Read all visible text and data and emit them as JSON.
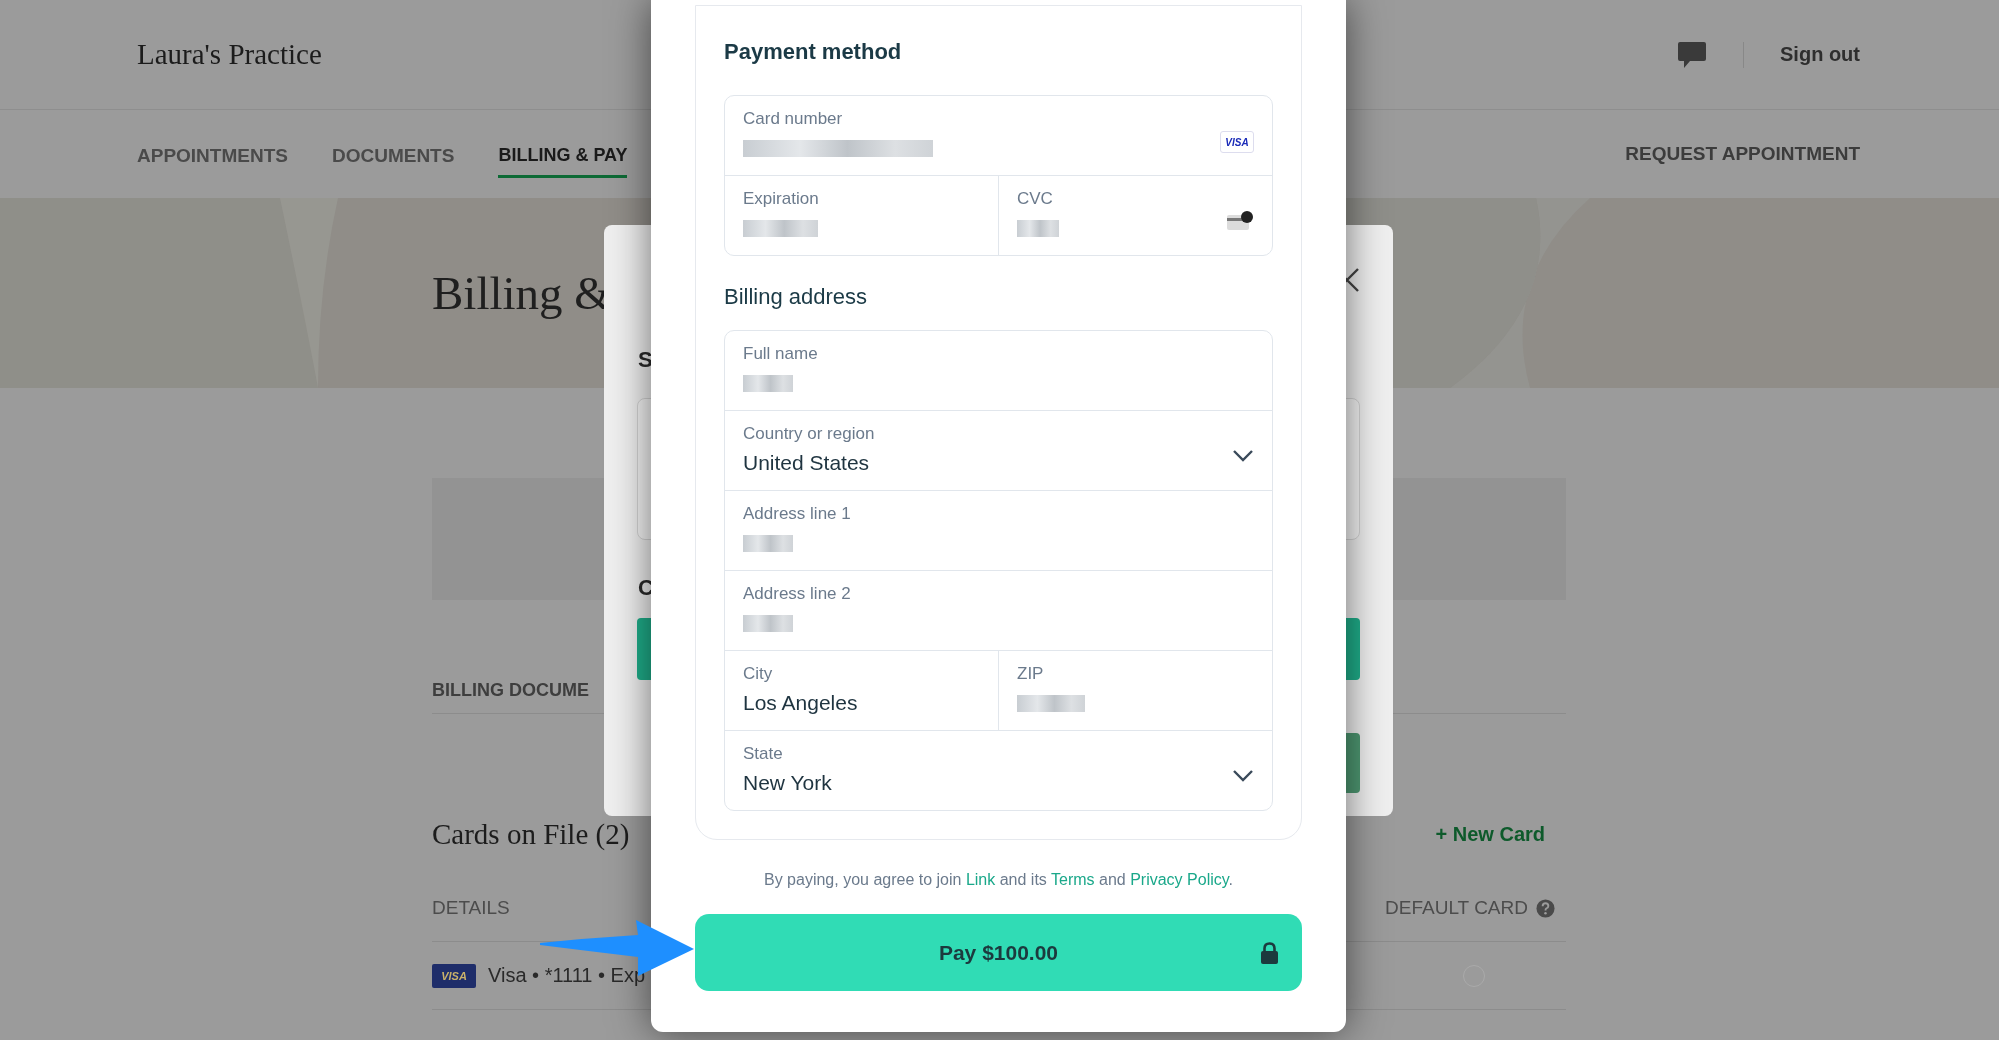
{
  "header": {
    "practice_name": "Laura's Practice",
    "sign_out": "Sign out"
  },
  "nav": {
    "tabs": [
      {
        "label": "APPOINTMENTS",
        "selected": false
      },
      {
        "label": "DOCUMENTS",
        "selected": false
      },
      {
        "label": "BILLING & PAY",
        "selected": true
      }
    ],
    "request_button": "REQUEST APPOINTMENT"
  },
  "page": {
    "title": "Billing &",
    "billing_documents_heading": "BILLING DOCUME",
    "cards_heading": "Cards on File (2)",
    "new_card_link": "+ New Card",
    "columns": [
      "DETAILS",
      "DEFAULT CARD"
    ],
    "cards": [
      {
        "brand": "VISA",
        "details": "Visa • *1111 • Exp",
        "default": false
      }
    ]
  },
  "background_dialog": {
    "heading_1": "S",
    "heading_2": "C"
  },
  "payment_dialog": {
    "payment_method": {
      "heading": "Payment method",
      "rows": [
        {
          "fields": [
            {
              "label": "Card number",
              "kind": "cardnumber",
              "redacted": true,
              "brand": "VISA"
            }
          ]
        },
        {
          "fields": [
            {
              "label": "Expiration",
              "kind": "expiry",
              "redacted": true
            },
            {
              "label": "CVC",
              "kind": "cvc",
              "redacted": true
            }
          ]
        }
      ]
    },
    "billing_address": {
      "heading": "Billing address",
      "rows": [
        {
          "fields": [
            {
              "label": "Full name",
              "kind": "text",
              "redacted": true
            }
          ]
        },
        {
          "fields": [
            {
              "label": "Country or region",
              "kind": "select",
              "value": "United States",
              "redacted": false
            }
          ]
        },
        {
          "fields": [
            {
              "label": "Address line 1",
              "kind": "text",
              "redacted": true
            }
          ]
        },
        {
          "fields": [
            {
              "label": "Address line 2",
              "kind": "text",
              "redacted": true
            }
          ]
        },
        {
          "fields": [
            {
              "label": "City",
              "kind": "text",
              "value": "Los Angeles",
              "redacted": false
            },
            {
              "label": "ZIP",
              "kind": "zip",
              "redacted": true
            }
          ]
        },
        {
          "fields": [
            {
              "label": "State",
              "kind": "select",
              "value": "New York",
              "redacted": false
            }
          ]
        }
      ]
    },
    "consent": [
      {
        "text": "By paying, you agree to join ",
        "kind": "plain"
      },
      {
        "text": "Link",
        "kind": "link"
      },
      {
        "text": " and its ",
        "kind": "plain"
      },
      {
        "text": "Terms",
        "kind": "link"
      },
      {
        "text": " and ",
        "kind": "plain"
      },
      {
        "text": "Privacy Policy",
        "kind": "link"
      },
      {
        "text": ".",
        "kind": "plain"
      }
    ],
    "pay_button": "Pay $100.00"
  }
}
